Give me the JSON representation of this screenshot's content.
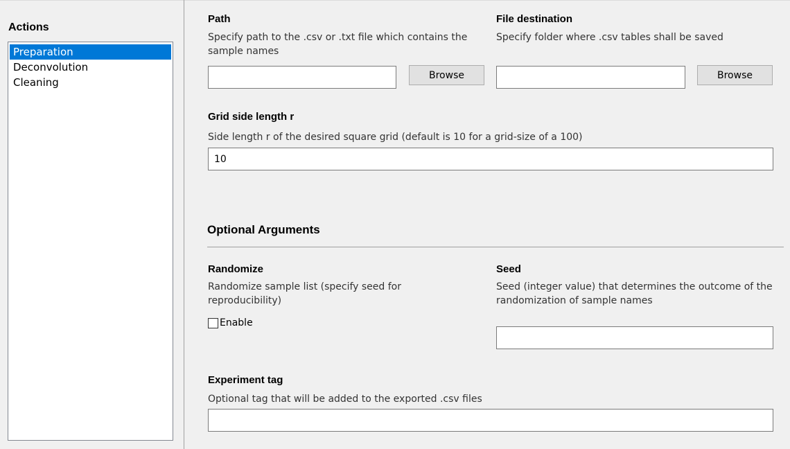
{
  "sidebar": {
    "title": "Actions",
    "items": [
      {
        "label": "Preparation",
        "selected": true
      },
      {
        "label": "Deconvolution",
        "selected": false
      },
      {
        "label": "Cleaning",
        "selected": false
      }
    ]
  },
  "path": {
    "heading": "Path",
    "description": "Specify path to the .csv or .txt file which contains the sample names",
    "value": "",
    "browse_label": "Browse"
  },
  "destination": {
    "heading": "File destination",
    "description": "Specify folder where .csv tables shall be saved",
    "value": "",
    "browse_label": "Browse"
  },
  "grid": {
    "heading": "Grid side length r",
    "description": "Side length r of the desired square grid (default is 10 for a grid-size of a 100)",
    "value": "10"
  },
  "optional": {
    "title": "Optional Arguments"
  },
  "randomize": {
    "heading": "Randomize",
    "description": "Randomize sample list (specify seed for reproducibility)",
    "checkbox_label": "Enable",
    "checked": false
  },
  "seed": {
    "heading": "Seed",
    "description": "Seed (integer value) that determines the outcome of the randomization of sample names",
    "value": ""
  },
  "tag": {
    "heading": "Experiment tag",
    "description": "Optional tag that will be added to the exported .csv files",
    "value": ""
  }
}
